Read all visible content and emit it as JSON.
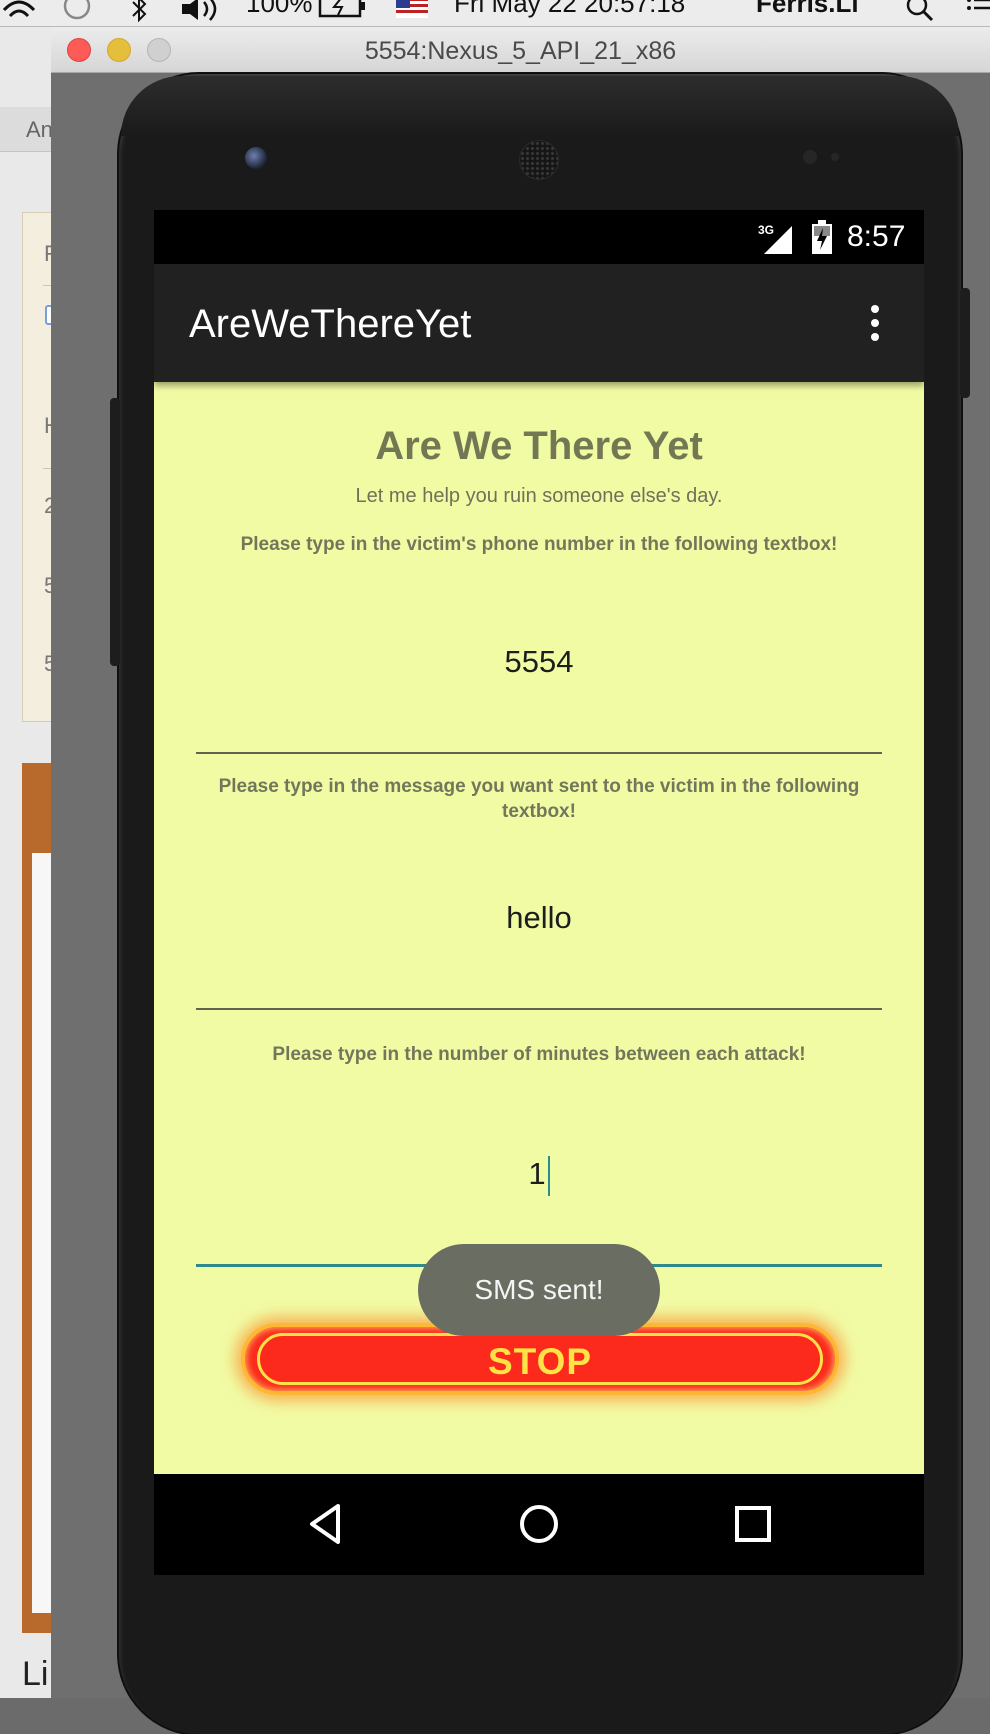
{
  "menubar": {
    "battery": "100%",
    "datetime": "Fri May 22  20:57:18",
    "user": "Ferris.Li"
  },
  "background_app": {
    "tab": "An",
    "panel_rows": [
      "F",
      "H",
      "2",
      "5",
      "5"
    ],
    "bottom_text": "Li"
  },
  "emulator": {
    "window_title": "5554:Nexus_5_API_21_x86"
  },
  "statusbar": {
    "network": "3G",
    "time": "8:57"
  },
  "appbar": {
    "title": "AreWeThereYet"
  },
  "content": {
    "heading": "Are We There Yet",
    "subheading": "Let me help you ruin someone else's day.",
    "phone_label": "Please type in the victim's phone number in the following textbox!",
    "phone_value": "5554",
    "message_label": "Please type in the message you want sent to the victim in the following textbox!",
    "message_value": "hello",
    "minutes_label": "Please type in the number of minutes between each attack!",
    "minutes_value": "1",
    "stop_button": "STOP"
  },
  "toast": {
    "text": "SMS sent!"
  },
  "colors": {
    "content_bg": "#f1fba4",
    "appbar_bg": "#212121",
    "stop_red": "#fb2a1d",
    "stop_text": "#ffe246",
    "accent_underline": "#2f8a8a"
  },
  "icons": [
    "wifi-icon",
    "time-machine-icon",
    "bluetooth-icon",
    "volume-icon",
    "battery-icon",
    "flag-icon",
    "search-icon",
    "list-icon",
    "signal-icon",
    "battery-charging-icon",
    "overflow-menu-icon",
    "back-icon",
    "home-icon",
    "recents-icon"
  ]
}
